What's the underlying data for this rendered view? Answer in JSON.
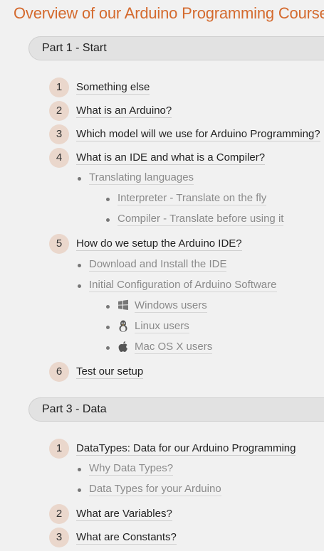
{
  "title": "Overview of our Arduino Programming Course",
  "parts": [
    {
      "header": "Part 1 - Start",
      "items": [
        {
          "num": "1",
          "label": "Something else"
        },
        {
          "num": "2",
          "label": "What is an Arduino?"
        },
        {
          "num": "3",
          "label": "Which model will we use for Arduino Programming?"
        },
        {
          "num": "4",
          "label": "What is an IDE and what is a Compiler?",
          "subs": [
            "Translating languages",
            "Interpreter - Translate on the fly",
            "Compiler - Translate before using it"
          ]
        },
        {
          "num": "5",
          "label": "How do we setup the Arduino IDE?",
          "subs": [
            "Download and Install the IDE",
            "Initial Configuration of Arduino Software",
            "Windows users",
            "Linux users",
            "Mac OS X users"
          ]
        },
        {
          "num": "6",
          "label": "Test our setup"
        }
      ]
    },
    {
      "header": "Part 3 - Data",
      "items": [
        {
          "num": "1",
          "label": "DataTypes: Data for our Arduino Programming",
          "subs": [
            "Why Data Types?",
            "Data Types for your Arduino"
          ]
        },
        {
          "num": "2",
          "label": "What are Variables?"
        },
        {
          "num": "3",
          "label": "What are Constants?"
        }
      ]
    }
  ],
  "icons": {
    "windows": "windows-icon",
    "linux": "linux-icon",
    "mac": "apple-icon"
  },
  "colors": {
    "title": "#d46a2e",
    "number_badge": "#ead7cc",
    "header_bg": "#e2e2e2",
    "sub_link": "#8a8a8a"
  }
}
